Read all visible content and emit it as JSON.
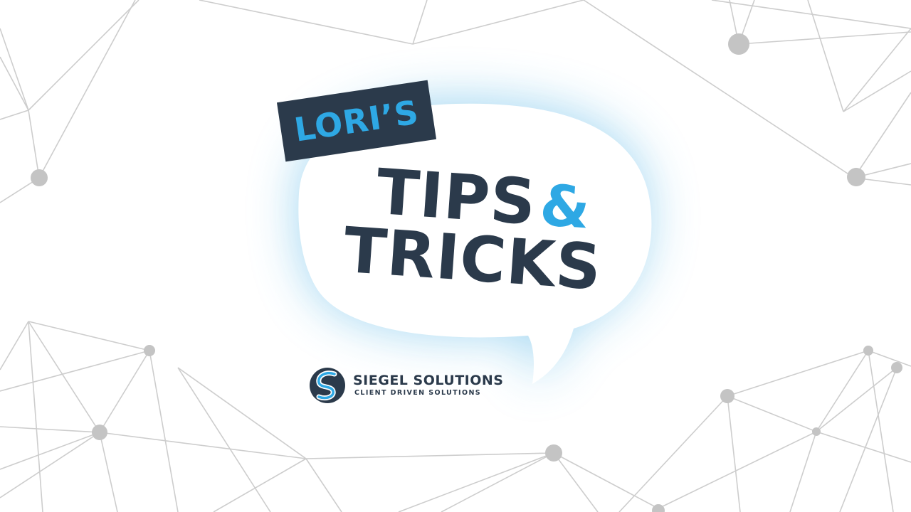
{
  "badge": {
    "label": "LORI’S"
  },
  "headline": {
    "line1": "TIPS",
    "ampersand": "&",
    "line2": "TRICKS"
  },
  "brand": {
    "name": "SIEGEL SOLUTIONS",
    "tagline": "CLIENT DRIVEN SOLUTIONS"
  },
  "colors": {
    "navy": "#2b3a4b",
    "accent_blue": "#2ea8e4",
    "network_lines": "#c9c9c9",
    "network_nodes": "#c4c4c4",
    "glow": "#a9d9f2"
  },
  "icons": {
    "brand_mark": "siegel-s-logo-icon",
    "background": "network-nodes-pattern"
  }
}
